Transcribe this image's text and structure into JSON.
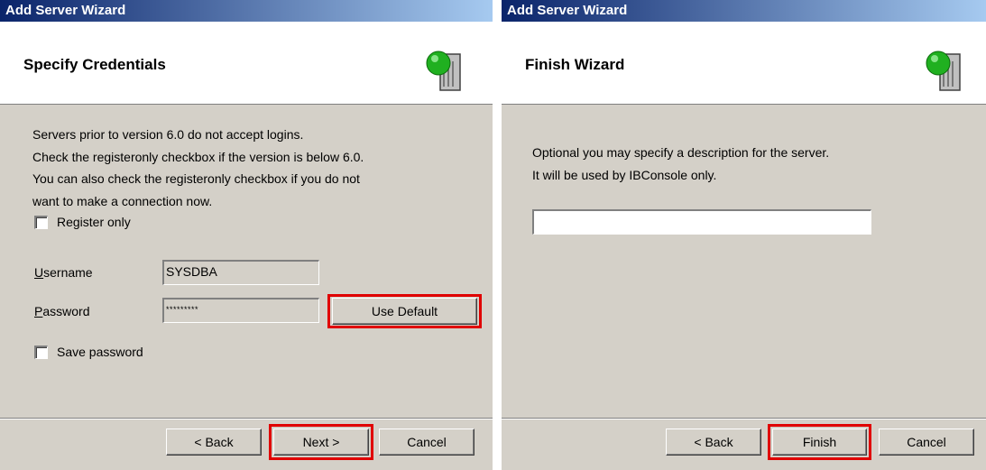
{
  "left_dialog": {
    "title": "Add Server Wizard",
    "header_title": "Specify Credentials",
    "icon": "server-globe-icon",
    "description": [
      "Servers prior to version 6.0 do not accept logins.",
      "Check the registeronly checkbox if the version is below 6.0.",
      "You can also check the registeronly checkbox if you do not",
      "want to make a connection now."
    ],
    "register_only_label": "Register only",
    "username_label_underlined": "U",
    "username_label_rest": "sername",
    "username_value": "SYSDBA",
    "password_label_underlined": "P",
    "password_label_rest": "assword",
    "password_value": "*********",
    "use_default_label": "Use Default",
    "save_password_label": "Save password",
    "back_label": "< Back",
    "next_label": "Next >",
    "cancel_label": "Cancel"
  },
  "right_dialog": {
    "title": "Add Server Wizard",
    "header_title": "Finish Wizard",
    "icon": "server-globe-icon",
    "description": [
      "Optional you may specify a description for the server.",
      "It will be used by IBConsole only."
    ],
    "description_value": "",
    "back_label": "< Back",
    "finish_label": "Finish",
    "cancel_label": "Cancel"
  },
  "colors": {
    "dialog_bg": "#d4d0c8",
    "titlebar_start": "#0a246a",
    "titlebar_end": "#a6caf0",
    "highlight": "#e00000"
  }
}
